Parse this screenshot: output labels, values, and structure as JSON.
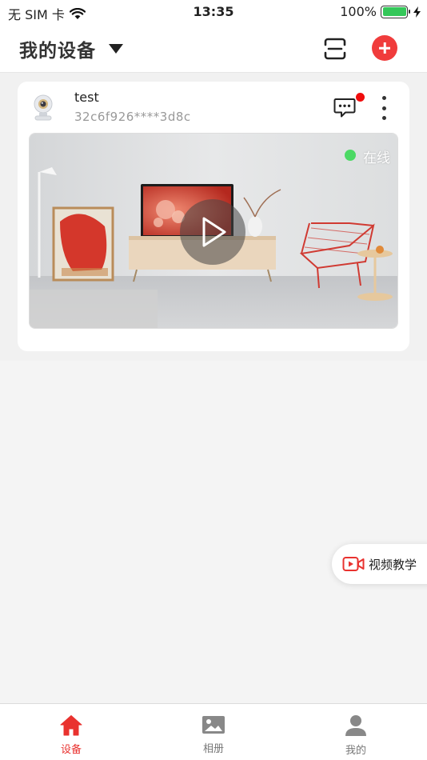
{
  "status_bar": {
    "carrier": "无 SIM 卡",
    "time": "13:35",
    "battery": "100%"
  },
  "header": {
    "title": "我的设备"
  },
  "device": {
    "name": "test",
    "id": "32c6f926****3d8c",
    "status": "在线"
  },
  "tutorial": {
    "label": "视频教学"
  },
  "tabs": [
    {
      "label": "设备",
      "icon": "home-icon",
      "active": true
    },
    {
      "label": "相册",
      "icon": "album-icon",
      "active": false
    },
    {
      "label": "我的",
      "icon": "person-icon",
      "active": false
    }
  ],
  "colors": {
    "accent": "#e9322f",
    "online": "#4cd964",
    "notification": "#f00c0c"
  }
}
